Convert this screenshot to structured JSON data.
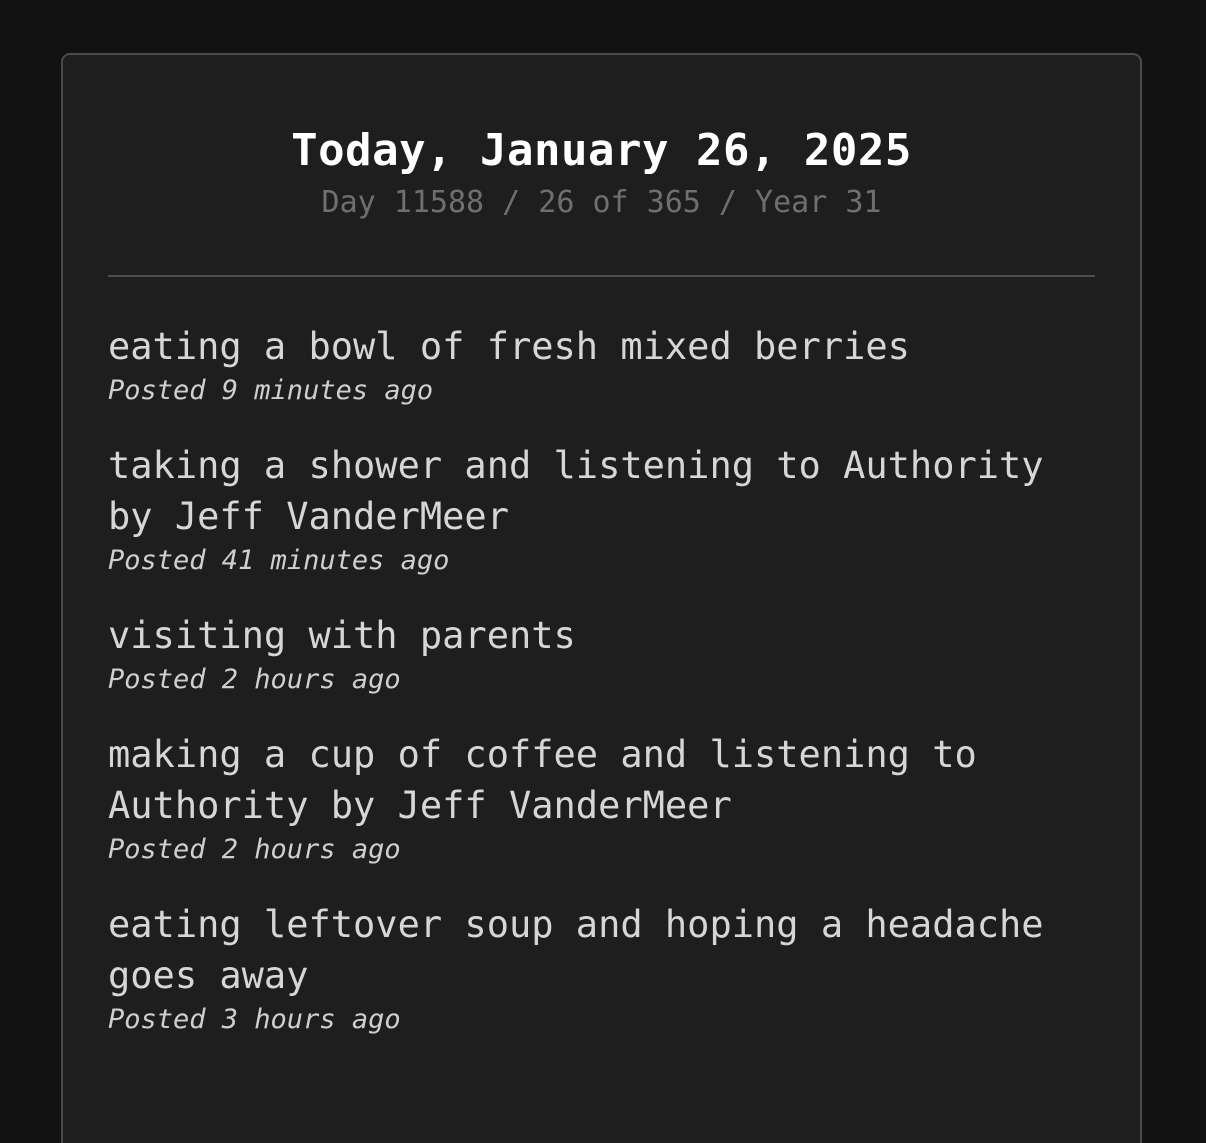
{
  "header": {
    "title": "Today, January 26, 2025",
    "subtitle": "Day 11588 / 26 of 365 / Year 31"
  },
  "entries": [
    {
      "text": "eating a bowl of fresh mixed berries",
      "meta": "Posted 9 minutes ago"
    },
    {
      "text": "taking a shower and listening to Authority by Jeff VanderMeer",
      "meta": "Posted 41 minutes ago"
    },
    {
      "text": "visiting with parents",
      "meta": "Posted 2 hours ago"
    },
    {
      "text": "making a cup of coffee and listening to Authority by Jeff VanderMeer",
      "meta": "Posted 2 hours ago"
    },
    {
      "text": "eating leftover soup and hoping a headache goes away",
      "meta": "Posted 3 hours ago"
    }
  ]
}
